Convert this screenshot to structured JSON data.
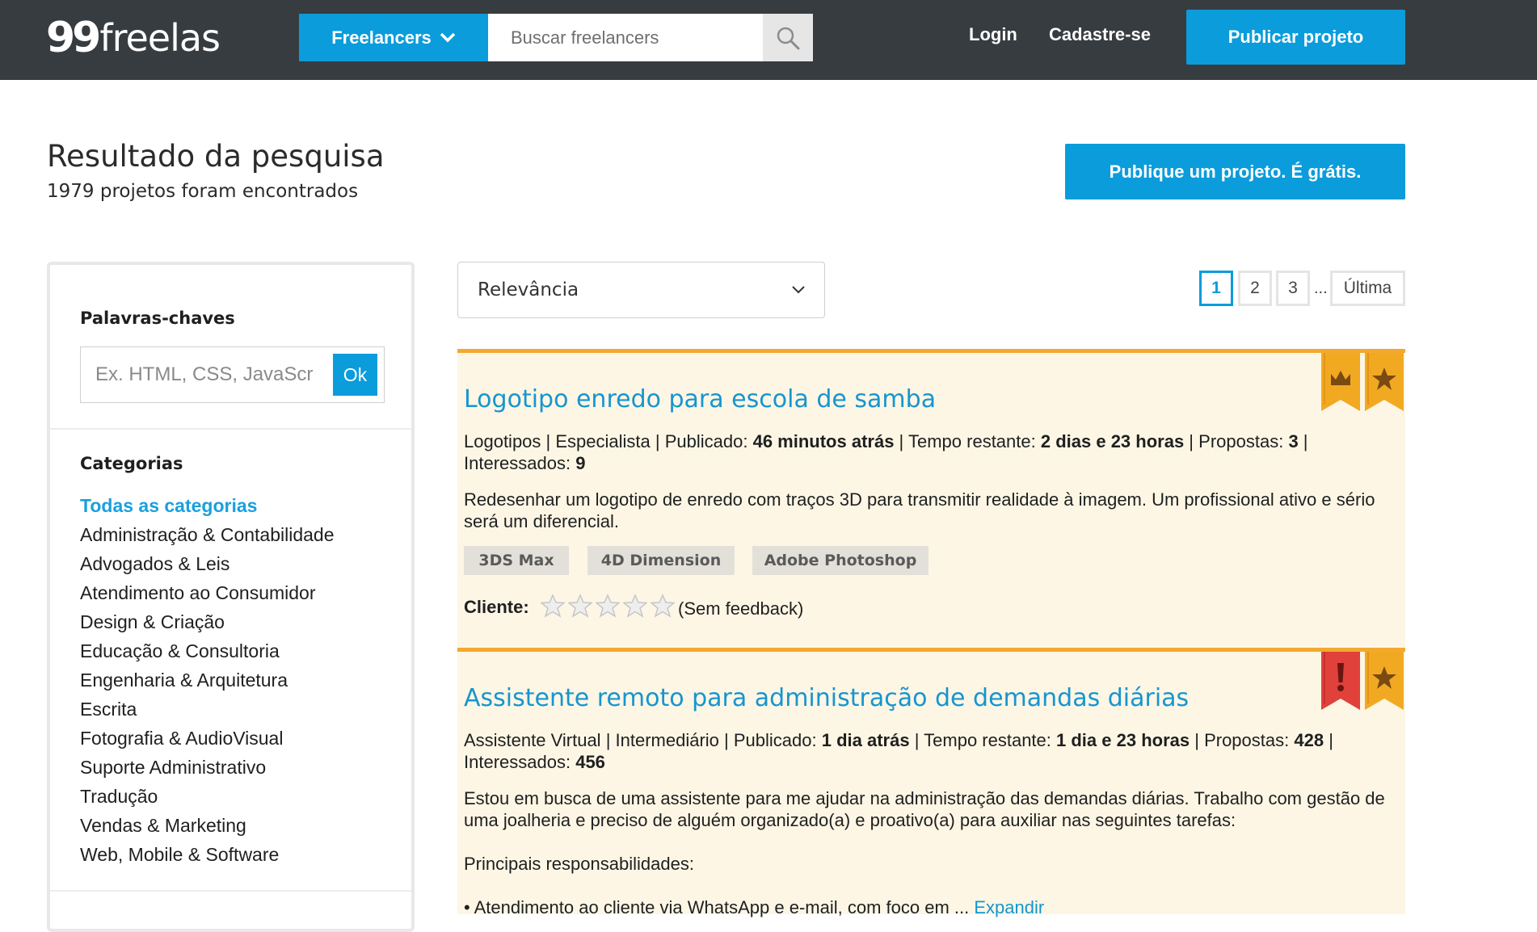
{
  "header": {
    "logo_text_1": "99",
    "logo_text_2": "freelas",
    "freelancers_label": "Freelancers",
    "search_placeholder": "Buscar freelancers",
    "login_label": "Login",
    "signup_label": "Cadastre-se",
    "publish_label": "Publicar projeto"
  },
  "page": {
    "title": "Resultado da pesquisa",
    "result_count": "1979 projetos foram encontrados",
    "publish_free_label": "Publique um projeto. É grátis."
  },
  "sidebar": {
    "keywords_heading": "Palavras-chaves",
    "keywords_placeholder": "Ex. HTML, CSS, JavaScript",
    "ok_label": "Ok",
    "categories_heading": "Categorias",
    "categories": [
      "Todas as categorias",
      "Administração & Contabilidade",
      "Advogados & Leis",
      "Atendimento ao Consumidor",
      "Design & Criação",
      "Educação & Consultoria",
      "Engenharia & Arquitetura",
      "Escrita",
      "Fotografia & AudioVisual",
      "Suporte Administrativo",
      "Tradução",
      "Vendas & Marketing",
      "Web, Mobile & Software"
    ]
  },
  "results": {
    "sort_selected": "Relevância",
    "pagination": [
      "1",
      "2",
      "3",
      "Última"
    ],
    "pagination_ellipsis": "...",
    "current_page": "1",
    "projects": [
      {
        "title": "Logotipo enredo para escola de samba",
        "category": "Logotipos",
        "level": "Especialista",
        "published_label": "Publicado:",
        "published": "46 minutos atrás",
        "remaining_label": "Tempo restante:",
        "remaining": "2 dias e 23 horas",
        "proposals_label": "Propostas:",
        "proposals": "3",
        "interested_label": "Interessados:",
        "interested": "9",
        "description": "Redesenhar um logotipo de enredo com traços 3D para transmitir realidade à imagem. Um profissional ativo e sério será um diferencial.",
        "skills": [
          "3DS Max",
          "4D Dimension",
          "Adobe Photoshop"
        ],
        "client_label": "Cliente:",
        "feedback": "(Sem feedback)",
        "rating": 0,
        "badges": [
          "crown-icon",
          "star-icon"
        ]
      },
      {
        "title": "Assistente remoto para administração de demandas diárias",
        "category": "Assistente Virtual",
        "level": "Intermediário",
        "published_label": "Publicado:",
        "published": "1 dia atrás",
        "remaining_label": "Tempo restante:",
        "remaining": "1 dia e 23 horas",
        "proposals_label": "Propostas:",
        "proposals": "428",
        "interested_label": "Interessados:",
        "interested": "456",
        "description": "Estou em busca de uma assistente para me ajudar na administração das demandas diárias. Trabalho com gestão de uma joalheria e preciso de alguém organizado(a) e proativo(a) para auxiliar nas seguintes tarefas:",
        "description_2": "Principais responsabilidades:",
        "description_3": "• Atendimento ao cliente via WhatsApp e e-mail, com foco em ...",
        "expand_label": "Expandir",
        "badges": [
          "exclamation-icon",
          "star-icon"
        ]
      }
    ]
  },
  "colors": {
    "header_bg": "#373c40",
    "brand_blue": "#0b9cdb",
    "link_blue": "#1795cf",
    "card_bg": "#fdf6e5",
    "card_accent": "#f3a92f",
    "ribbon_gold": "#f2a922",
    "ribbon_red": "#e0413a"
  }
}
